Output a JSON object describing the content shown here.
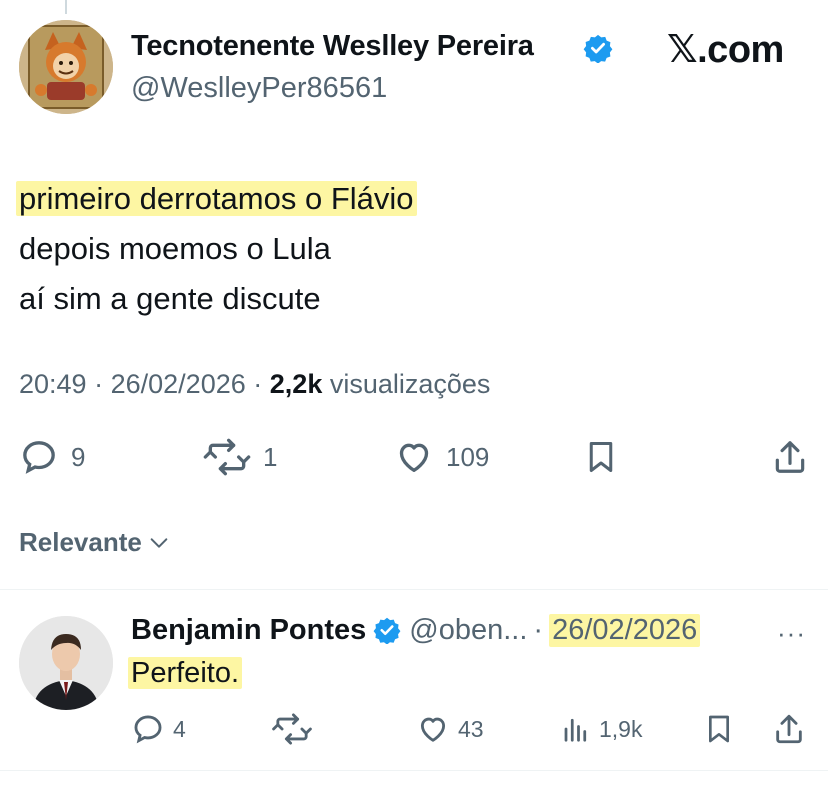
{
  "tweet": {
    "author_name": "Tecnotenente Weslley Pereira",
    "author_handle": "@WeslleyPer86561",
    "watermark_x": "𝕏",
    "watermark_suffix": ".com",
    "lines": [
      "primeiro derrotamos o Flávio",
      "depois moemos o Lula",
      "aí sim a gente discute"
    ],
    "time": "20:49",
    "separator": "·",
    "date": "26/02/2026",
    "views_count": "2,2k",
    "views_label": "visualizações",
    "replies": "9",
    "reposts": "1",
    "likes": "109"
  },
  "sort": {
    "label": "Relevante"
  },
  "reply": {
    "author_name": "Benjamin Pontes",
    "author_handle": "@oben...",
    "separator": "·",
    "date": "26/02/2026",
    "more": "···",
    "text": "Perfeito.",
    "replies": "4",
    "likes": "43",
    "views": "1,9k"
  },
  "colors": {
    "highlight": "#fdf6a3",
    "verified": "#1d9bf0",
    "secondary_text": "#536471"
  },
  "icons": [
    "verified-badge-icon",
    "reply-icon",
    "repost-icon",
    "like-icon",
    "bookmark-icon",
    "share-icon",
    "views-icon",
    "chevron-down-icon",
    "more-icon"
  ]
}
